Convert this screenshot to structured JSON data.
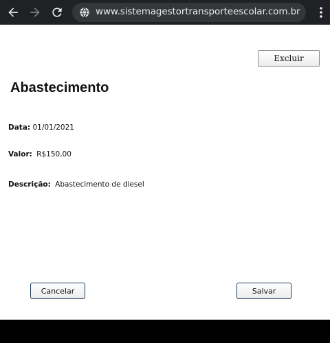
{
  "browser": {
    "url": "www.sistemagestortransporteescolar.com.br",
    "icons": {
      "back": "arrow-left-icon",
      "forward": "arrow-right-icon",
      "reload": "reload-icon",
      "site": "globe-icon",
      "menu": "more-vertical-icon"
    }
  },
  "page": {
    "delete_label": "Excluir",
    "title": "Abastecimento",
    "fields": {
      "date": {
        "label": "Data:",
        "value": "01/01/2021"
      },
      "value": {
        "label": "Valor:",
        "value": "R$150,00"
      },
      "description": {
        "label": "Descrição:",
        "value": "Abastecimento de diesel"
      }
    },
    "cancel_label": "Cancelar",
    "save_label": "Salvar"
  }
}
